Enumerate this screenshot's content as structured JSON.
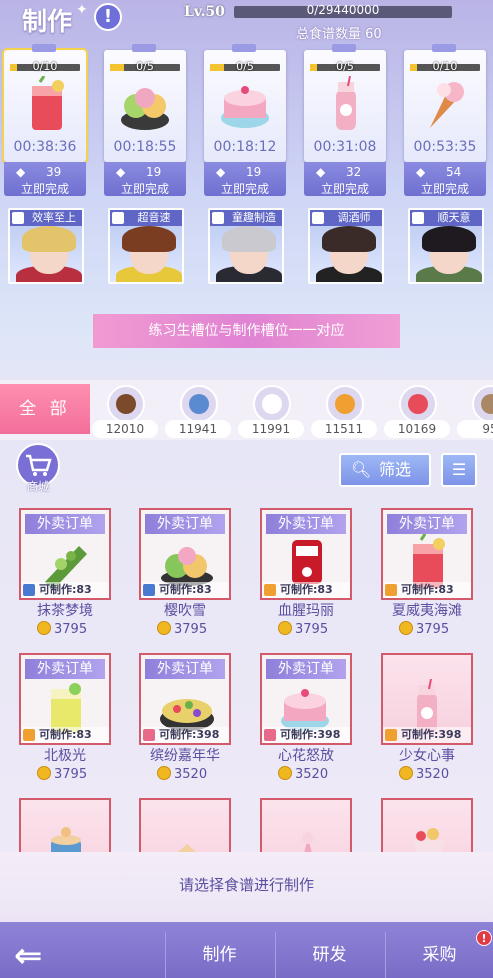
{
  "header": {
    "title": "制作",
    "info_icon": "!",
    "level": "Lv.50",
    "exp": "0/29440000",
    "exp_fraction": 0,
    "recipe_total": "总食谱数量 60"
  },
  "slots": [
    {
      "progress": "0/10",
      "progress_fraction": 0.1,
      "timer": "00:38:36",
      "gem_cost": "39",
      "finish": "立即完成",
      "selected": true,
      "food": "drink-red"
    },
    {
      "progress": "0/5",
      "progress_fraction": 0.2,
      "timer": "00:18:55",
      "gem_cost": "19",
      "finish": "立即完成",
      "food": "mochi-green"
    },
    {
      "progress": "0/5",
      "progress_fraction": 0.2,
      "timer": "00:18:12",
      "gem_cost": "19",
      "finish": "立即完成",
      "food": "cake-pink"
    },
    {
      "progress": "0/5",
      "progress_fraction": 0.1,
      "timer": "00:31:08",
      "gem_cost": "32",
      "finish": "立即完成",
      "food": "milk-bottle"
    },
    {
      "progress": "0/10",
      "progress_fraction": 0.1,
      "timer": "00:53:35",
      "gem_cost": "54",
      "finish": "立即完成",
      "food": "ice-cream-cone"
    }
  ],
  "helpers": [
    {
      "label": "效率至上",
      "hair": "#e3c46a",
      "body": "#b83040"
    },
    {
      "label": "超音速",
      "hair": "#7a3d22",
      "body": "#e6c83a"
    },
    {
      "label": "童趣制造",
      "hair": "#c9c9cf",
      "body": "#2a2a32"
    },
    {
      "label": "调酒师",
      "hair": "#3a2a28",
      "body": "#222"
    },
    {
      "label": "顺天意",
      "hair": "#1e1a20",
      "body": "#5a7a4a"
    }
  ],
  "banner": "练习生槽位与制作槽位一一对应",
  "categories": {
    "all_label": "全 部",
    "items": [
      {
        "icon": "cupcake-icon",
        "count": "12010"
      },
      {
        "icon": "syringe-icon",
        "count": "11941"
      },
      {
        "icon": "bowl-icon",
        "count": "11991"
      },
      {
        "icon": "honey-jar-icon",
        "count": "11511"
      },
      {
        "icon": "fruit-tart-icon",
        "count": "10169"
      },
      {
        "icon": "ingredient-icon",
        "count": "95"
      }
    ]
  },
  "shop_label": "商城",
  "filter_label": "筛选",
  "recipes": [
    {
      "tag": "外卖订单",
      "avail": "可制作:83",
      "name": "抹茶梦境",
      "price": "3795",
      "food": "matcha"
    },
    {
      "tag": "外卖订单",
      "avail": "可制作:83",
      "name": "樱吹雪",
      "price": "3795",
      "food": "mochi"
    },
    {
      "tag": "外卖订单",
      "avail": "可制作:83",
      "name": "血腥玛丽",
      "price": "3795",
      "food": "blood-bag"
    },
    {
      "tag": "外卖订单",
      "avail": "可制作:83",
      "name": "夏威夷海滩",
      "price": "3795",
      "food": "drink-red"
    },
    {
      "tag": "外卖订单",
      "avail": "可制作:83",
      "name": "北极光",
      "price": "3795",
      "food": "drink-yellow"
    },
    {
      "tag": "外卖订单",
      "avail": "可制作:398",
      "name": "缤纷嘉年华",
      "price": "3520",
      "food": "party-cake"
    },
    {
      "tag": "外卖订单",
      "avail": "可制作:398",
      "name": "心花怒放",
      "price": "3520",
      "food": "cake-pink"
    },
    {
      "tag": "",
      "avail": "可制作:398",
      "name": "少女心事",
      "price": "3520",
      "food": "milk-bottle"
    },
    {
      "tag": "",
      "avail": "",
      "name": "",
      "price": "",
      "food": "coffee-cup"
    },
    {
      "tag": "",
      "avail": "",
      "name": "",
      "price": "",
      "food": "cake-slices"
    },
    {
      "tag": "",
      "avail": "",
      "name": "",
      "price": "",
      "food": "pink-dessert"
    },
    {
      "tag": "",
      "avail": "",
      "name": "",
      "price": "",
      "food": "parfait"
    }
  ],
  "prompt": "请选择食谱进行制作",
  "nav": {
    "make": "制作",
    "research": "研发",
    "purchase": "采购",
    "badge": "!"
  }
}
